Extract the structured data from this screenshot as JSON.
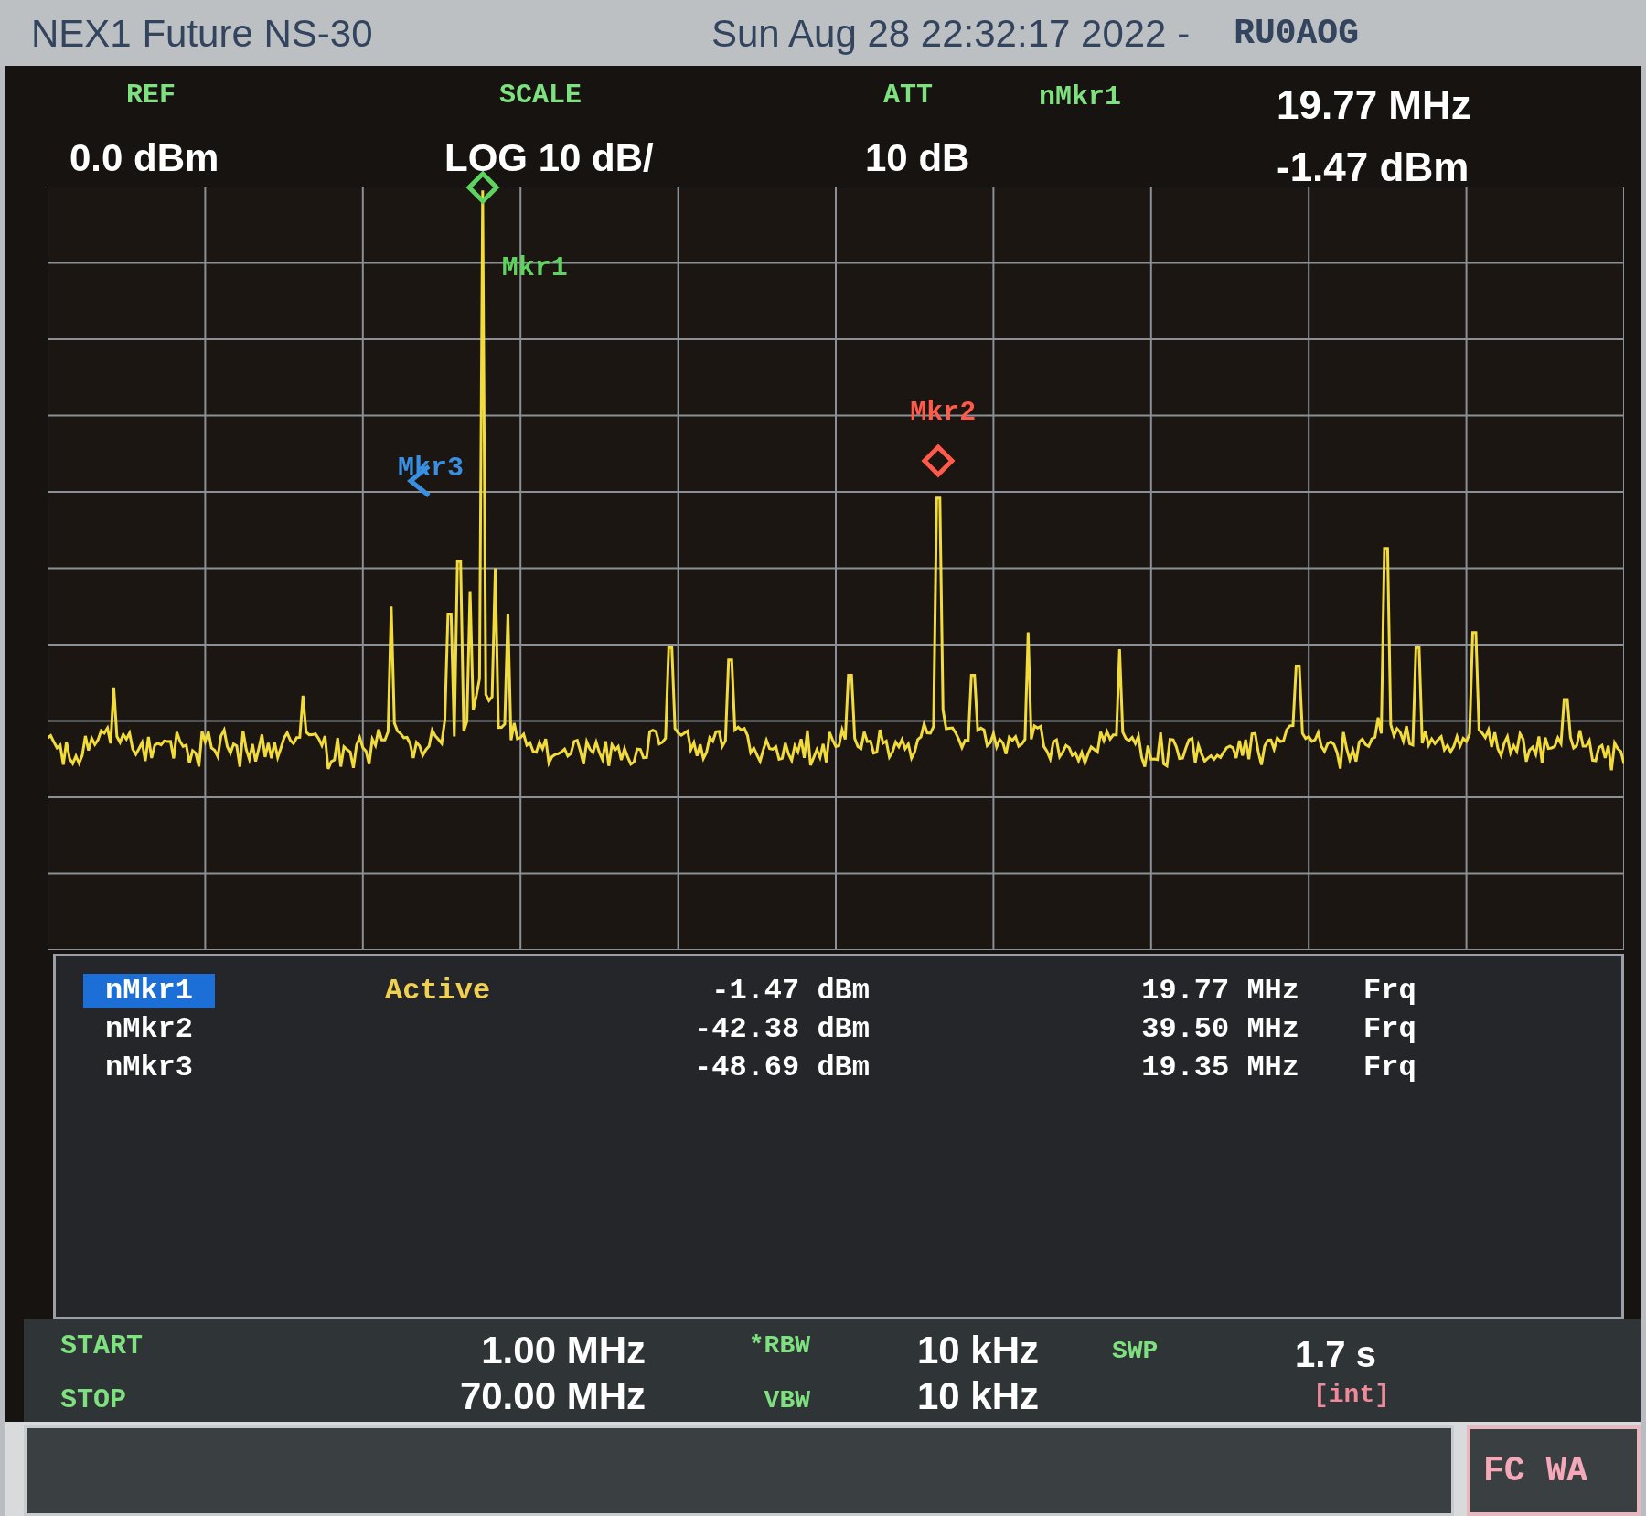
{
  "title_bar": {
    "instrument": "NEX1 Future NS-30",
    "datetime": "Sun Aug 28 22:32:17 2022 -",
    "callsign": "RU0AOG"
  },
  "header": {
    "ref": {
      "label": "REF",
      "value": "0.0 dBm"
    },
    "scale": {
      "label": "SCALE",
      "value": "LOG 10 dB/"
    },
    "att": {
      "label": "ATT",
      "value": "10 dB"
    },
    "marker": {
      "label": "nMkr1",
      "frequency": "19.77 MHz",
      "amplitude": "-1.47 dBm"
    }
  },
  "trace_markers": [
    {
      "label": "Mkr1",
      "color": "#5fd35f"
    },
    {
      "label": "Mkr2",
      "color": "#ff5a4a"
    },
    {
      "label": "Mkr3",
      "color": "#3a8fe0"
    }
  ],
  "marker_table": [
    {
      "name": "nMkr1",
      "selected": true,
      "status": "Active",
      "amplitude": "-1.47 dBm",
      "frequency": "19.77 MHz",
      "mode": "Frq"
    },
    {
      "name": "nMkr2",
      "selected": false,
      "amplitude": "-42.38 dBm",
      "frequency": "39.50 MHz",
      "mode": "Frq"
    },
    {
      "name": "nMkr3",
      "selected": false,
      "amplitude": "-48.69 dBm",
      "frequency": "19.35 MHz",
      "mode": "Frq"
    }
  ],
  "footer": {
    "start": {
      "label": "START",
      "value": "1.00 MHz"
    },
    "stop": {
      "label": "STOP",
      "value": "70.00 MHz"
    },
    "rbw": {
      "label": "*RBW",
      "value": "10 kHz"
    },
    "vbw": {
      "label": "VBW",
      "value": "10 kHz"
    },
    "swp": {
      "label": "SWP",
      "value": "1.7 s"
    },
    "trigger": "[int]"
  },
  "status": {
    "text": "FC WA"
  }
}
